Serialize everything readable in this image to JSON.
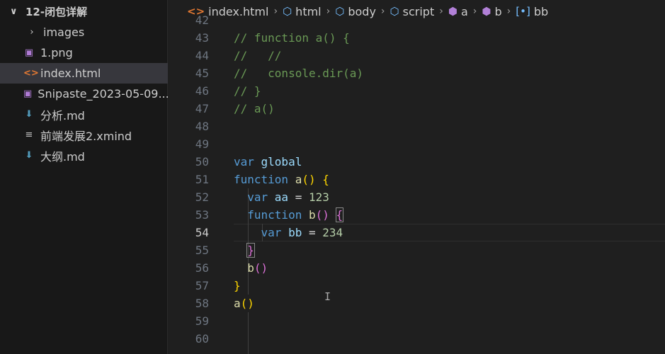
{
  "explorer": {
    "folder": "12-闭包详解",
    "items": [
      {
        "label": "images",
        "icon": "chevron-right-icon"
      },
      {
        "label": "1.png",
        "icon": "image-file-icon"
      },
      {
        "label": "index.html",
        "icon": "html-file-icon",
        "active": true
      },
      {
        "label": "Snipaste_2023-05-09...",
        "icon": "image-file-icon"
      },
      {
        "label": "分析.md",
        "icon": "markdown-file-icon"
      },
      {
        "label": "前端发展2.xmind",
        "icon": "text-file-icon"
      },
      {
        "label": "大纲.md",
        "icon": "markdown-file-icon"
      }
    ]
  },
  "breadcrumb": [
    "index.html",
    "html",
    "body",
    "script",
    "a",
    "b",
    "bb"
  ],
  "editor": {
    "current_line": 54,
    "line_numbers": [
      "42",
      "43",
      "44",
      "45",
      "46",
      "47",
      "48",
      "49",
      "50",
      "51",
      "52",
      "53",
      "54",
      "55",
      "56",
      "57",
      "58",
      "59",
      "60"
    ],
    "lines": [
      {
        "num": "43",
        "tokens": [
          {
            "t": "// function a() {",
            "c": "c"
          }
        ]
      },
      {
        "num": "44",
        "tokens": [
          {
            "t": "//   //",
            "c": "c"
          }
        ]
      },
      {
        "num": "45",
        "tokens": [
          {
            "t": "//   console.dir(a)",
            "c": "c"
          }
        ]
      },
      {
        "num": "46",
        "tokens": [
          {
            "t": "// }",
            "c": "c"
          }
        ]
      },
      {
        "num": "47",
        "tokens": [
          {
            "t": "// a()",
            "c": "c"
          }
        ]
      },
      {
        "num": "50",
        "tokens": [
          {
            "t": "var ",
            "c": "k"
          },
          {
            "t": "global",
            "c": "v"
          }
        ]
      },
      {
        "num": "51",
        "tokens": [
          {
            "t": "function ",
            "c": "k"
          },
          {
            "t": "a",
            "c": "f"
          },
          {
            "t": "()",
            "c": "b1"
          },
          {
            "t": " ",
            "c": "o"
          },
          {
            "t": "{",
            "c": "b1"
          }
        ]
      },
      {
        "num": "52",
        "tokens": [
          {
            "t": "  var ",
            "c": "k"
          },
          {
            "t": "aa",
            "c": "v"
          },
          {
            "t": " = ",
            "c": "o"
          },
          {
            "t": "123",
            "c": "n"
          }
        ]
      },
      {
        "num": "53",
        "tokens": [
          {
            "t": "  function ",
            "c": "k"
          },
          {
            "t": "b",
            "c": "f"
          },
          {
            "t": "()",
            "c": "b2"
          },
          {
            "t": " ",
            "c": "o"
          },
          {
            "t": "{",
            "c": "b2 hl"
          }
        ]
      },
      {
        "num": "54",
        "tokens": [
          {
            "t": "    var ",
            "c": "k"
          },
          {
            "t": "bb",
            "c": "v"
          },
          {
            "t": " = ",
            "c": "o"
          },
          {
            "t": "234",
            "c": "n"
          }
        ]
      },
      {
        "num": "55",
        "tokens": [
          {
            "t": "  ",
            "c": "o"
          },
          {
            "t": "}",
            "c": "b2 hl"
          }
        ]
      },
      {
        "num": "56",
        "tokens": [
          {
            "t": "  ",
            "c": "o"
          },
          {
            "t": "b",
            "c": "f"
          },
          {
            "t": "()",
            "c": "b2"
          }
        ]
      },
      {
        "num": "57",
        "tokens": [
          {
            "t": "}",
            "c": "b1"
          }
        ]
      },
      {
        "num": "58",
        "tokens": [
          {
            "t": "a",
            "c": "f"
          },
          {
            "t": "()",
            "c": "b1"
          }
        ]
      }
    ]
  }
}
